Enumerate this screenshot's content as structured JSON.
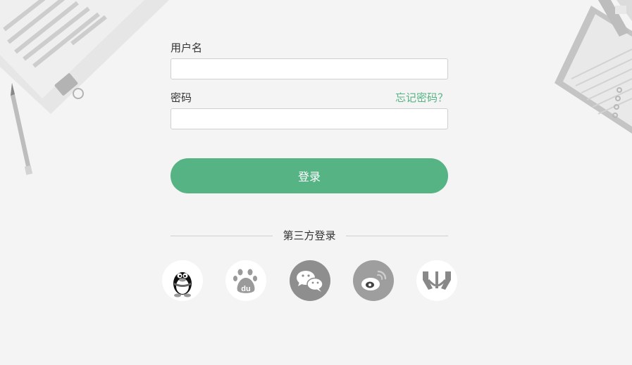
{
  "form": {
    "username_label": "用户名",
    "username_value": "",
    "password_label": "密码",
    "password_value": "",
    "forgot_link": "忘记密码？",
    "login_button": "登录"
  },
  "third_party": {
    "label": "第三方登录",
    "providers": [
      {
        "name": "QQ",
        "icon": "qq-icon"
      },
      {
        "name": "Baidu",
        "icon": "baidu-icon"
      },
      {
        "name": "WeChat",
        "icon": "wechat-icon"
      },
      {
        "name": "Weibo",
        "icon": "weibo-icon"
      },
      {
        "name": "Renren",
        "icon": "renren-icon"
      }
    ]
  },
  "colors": {
    "accent": "#55b384",
    "background": "#f4f4f4",
    "input_border": "#cfcfcf"
  }
}
